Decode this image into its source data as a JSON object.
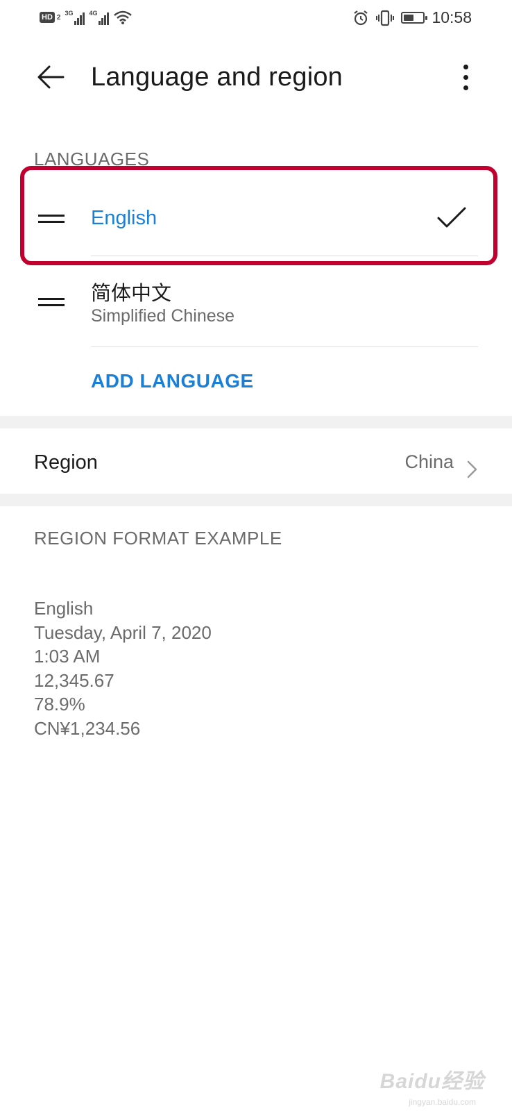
{
  "status_bar": {
    "hd_label": "HD",
    "hd_sub": "2",
    "net1_label": "3G",
    "net2_label": "4G",
    "time": "10:58",
    "battery_level": 0.55,
    "icons": [
      "signal-icon",
      "wifi-icon",
      "alarm-icon",
      "vibrate-icon",
      "battery-icon"
    ]
  },
  "header": {
    "title": "Language and region",
    "back_icon": "back-arrow-icon",
    "more_icon": "more-vert-icon"
  },
  "languages": {
    "section_label": "LANGUAGES",
    "items": [
      {
        "name": "English",
        "subtitle": "",
        "selected": true
      },
      {
        "name": "简体中文",
        "subtitle": "Simplified Chinese",
        "selected": false
      }
    ],
    "add_label": "ADD LANGUAGE"
  },
  "region": {
    "label": "Region",
    "value": "China"
  },
  "format_example": {
    "section_label": "REGION FORMAT EXAMPLE",
    "lines": [
      "English",
      "Tuesday, April 7, 2020",
      "1:03 AM",
      "12,345.67",
      "78.9%",
      "CN¥1,234.56"
    ]
  },
  "watermark": {
    "text": "Baidu经验",
    "sub": "jingyan.baidu.com"
  },
  "colors": {
    "accent": "#1a7fd6",
    "highlight": "#c0002e",
    "secondary_text": "#6b6b6b"
  }
}
